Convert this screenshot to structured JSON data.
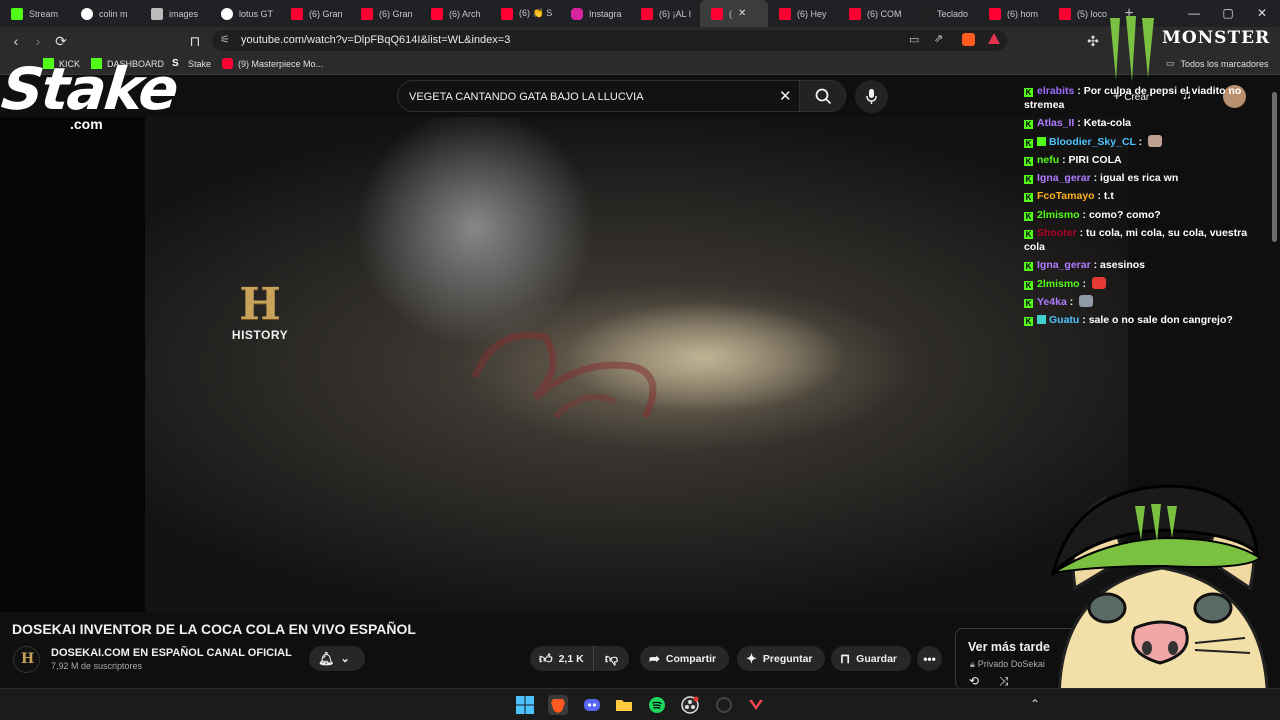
{
  "tabs": [
    {
      "label": "Stream",
      "icon": "kick-icon",
      "color": "#53fc18"
    },
    {
      "label": "colin m",
      "icon": "google-icon",
      "color": "#ffffff"
    },
    {
      "label": "images",
      "icon": "globe-icon",
      "color": "#bbbbbb"
    },
    {
      "label": "lotus GT",
      "icon": "google-icon",
      "color": "#ffffff"
    },
    {
      "label": "(6) Gran",
      "icon": "youtube-icon",
      "color": "#ff0033"
    },
    {
      "label": "(6) Gran",
      "icon": "youtube-icon",
      "color": "#ff0033"
    },
    {
      "label": "(6) Arch",
      "icon": "youtube-icon",
      "color": "#ff0033"
    },
    {
      "label": "(6) 👏 S",
      "icon": "youtube-icon",
      "color": "#ff0033"
    },
    {
      "label": "Instagra",
      "icon": "instagram-icon",
      "color": "#d6249f"
    },
    {
      "label": "(6) ¡AL I",
      "icon": "youtube-icon",
      "color": "#ff0033"
    },
    {
      "label": "(",
      "icon": "youtube-icon",
      "color": "#ff0033",
      "active": true
    },
    {
      "label": "(6) Hey",
      "icon": "youtube-icon",
      "color": "#ff0033"
    },
    {
      "label": "(6) COM",
      "icon": "youtube-icon",
      "color": "#ff0033"
    },
    {
      "label": "Teclado",
      "icon": "tiktok-icon",
      "color": "#222222"
    },
    {
      "label": "(6) hom",
      "icon": "youtube-icon",
      "color": "#ff0033"
    },
    {
      "label": "(5) loco",
      "icon": "youtube-icon",
      "color": "#ff0033"
    }
  ],
  "address": {
    "url": "youtube.com/watch?v=DlpFBqQ614I&list=WL&index=3"
  },
  "bookmarks": [
    {
      "label": "KICK",
      "icon": "kick-icon"
    },
    {
      "label": "DASHBOARD",
      "icon": "kick-icon"
    },
    {
      "label": "Stake",
      "icon": "stake-icon"
    },
    {
      "label": "(9) Masterpiece Mo...",
      "icon": "youtube-icon"
    }
  ],
  "all_bookmarks": "Todos los marcadores",
  "search": {
    "query": "VEGETA CANTANDO GATA BAJO LA LLUCVIA"
  },
  "header": {
    "create_label": "Crear"
  },
  "overlay": {
    "stake_word": "Stake",
    "stake_com": ".com",
    "monster_word": "MONSTER",
    "history_h": "H",
    "history_word": "HISTORY"
  },
  "chat": [
    {
      "user": "elrabits",
      "color": "#9b6cff",
      "msg": "Por culpa de pepsi el viadito no stremea"
    },
    {
      "user": "Atlas_II",
      "color": "#b07cff",
      "msg": "Keta-cola"
    },
    {
      "user": "Bloodier_Sky_CL",
      "color": "#4fc3ff",
      "msg": "",
      "emote": "#c0a090",
      "badge2": "#53fc18"
    },
    {
      "user": "nefu",
      "color": "#53fc18",
      "msg": "PIRI COLA"
    },
    {
      "user": "Igna_gerar",
      "color": "#b07cff",
      "msg": "igual es rica wn"
    },
    {
      "user": "FcoTamayo",
      "color": "#ffb020",
      "msg": "t.t"
    },
    {
      "user": "2lmismo",
      "color": "#53fc18",
      "msg": "como? como?"
    },
    {
      "user": "Shooter",
      "color": "#b0002a",
      "msg": "tu cola, mi cola, su cola, vuestra cola"
    },
    {
      "user": "Igna_gerar",
      "color": "#b07cff",
      "msg": "asesinos"
    },
    {
      "user": "2lmismo",
      "color": "#53fc18",
      "msg": "",
      "emote": "#e53935"
    },
    {
      "user": "Ye4ka",
      "color": "#b07cff",
      "msg": "",
      "emote": "#8f9aa8"
    },
    {
      "user": "Guatu",
      "color": "#4fc3ff",
      "msg": "sale o no sale don cangrejo?",
      "badge2": "#3fd0c9"
    }
  ],
  "video": {
    "title": "DOSEKAI INVENTOR DE LA COCA COLA EN VIVO ESPAÑOL",
    "channel": "DOSEKAI.COM EN ESPAÑOL CANAL OFICIAL",
    "subs": "7,92 M de suscriptores",
    "likes": "2,1 K",
    "share": "Compartir",
    "ask": "Preguntar",
    "save": "Guardar"
  },
  "see_later": {
    "title": "Ver más tarde",
    "sub": "Privado DoSekai"
  },
  "accent": "#ff0033"
}
